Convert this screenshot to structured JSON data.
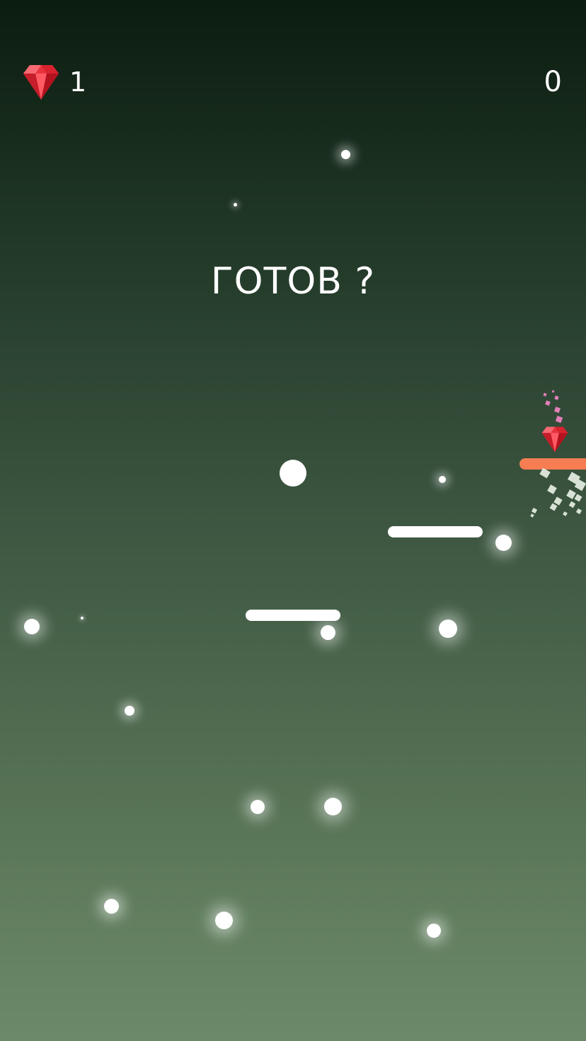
{
  "hud": {
    "gem_icon": "red-gem-icon",
    "gem_count": "1",
    "score": "0"
  },
  "prompt": "ГОТОВ ?",
  "colors": {
    "gem": "#ef3e4a",
    "orange_platform": "#f77e53",
    "platform": "#ffffff",
    "ball": "#ffffff"
  }
}
